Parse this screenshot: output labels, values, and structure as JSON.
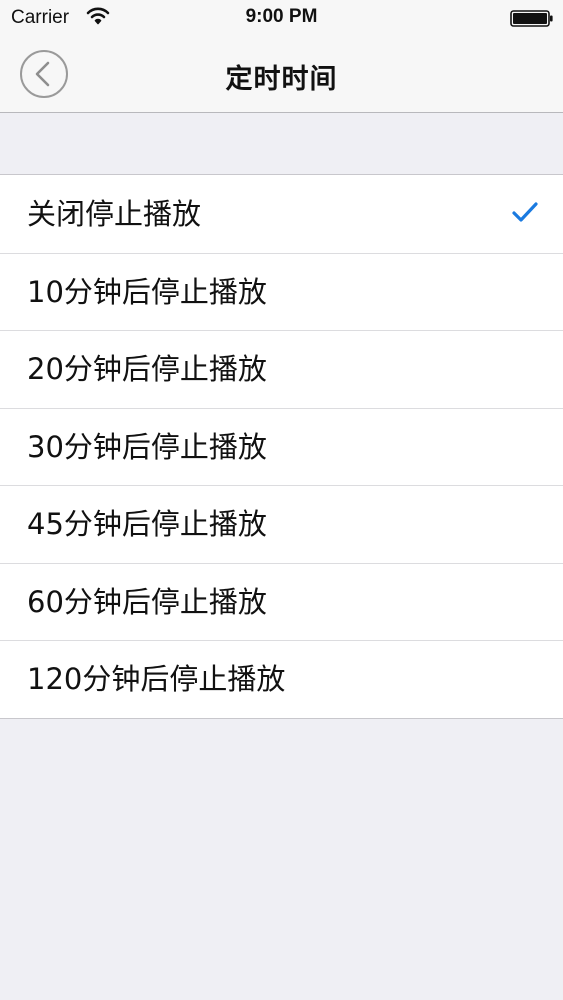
{
  "status_bar": {
    "carrier": "Carrier",
    "time": "9:00 PM",
    "wifi_icon": "wifi-icon",
    "battery_icon": "battery-icon"
  },
  "nav_bar": {
    "title": "定时时间",
    "back_icon": "chevron-left-icon"
  },
  "timer_options": [
    {
      "label": "关闭停止播放",
      "selected": true
    },
    {
      "label": "10分钟后停止播放",
      "selected": false
    },
    {
      "label": "20分钟后停止播放",
      "selected": false
    },
    {
      "label": "30分钟后停止播放",
      "selected": false
    },
    {
      "label": "45分钟后停止播放",
      "selected": false
    },
    {
      "label": "60分钟后停止播放",
      "selected": false
    },
    {
      "label": "120分钟后停止播放",
      "selected": false
    }
  ],
  "colors": {
    "accent": "#1a7ae0",
    "background": "#efeff4",
    "nav_background": "#f7f7f7"
  }
}
